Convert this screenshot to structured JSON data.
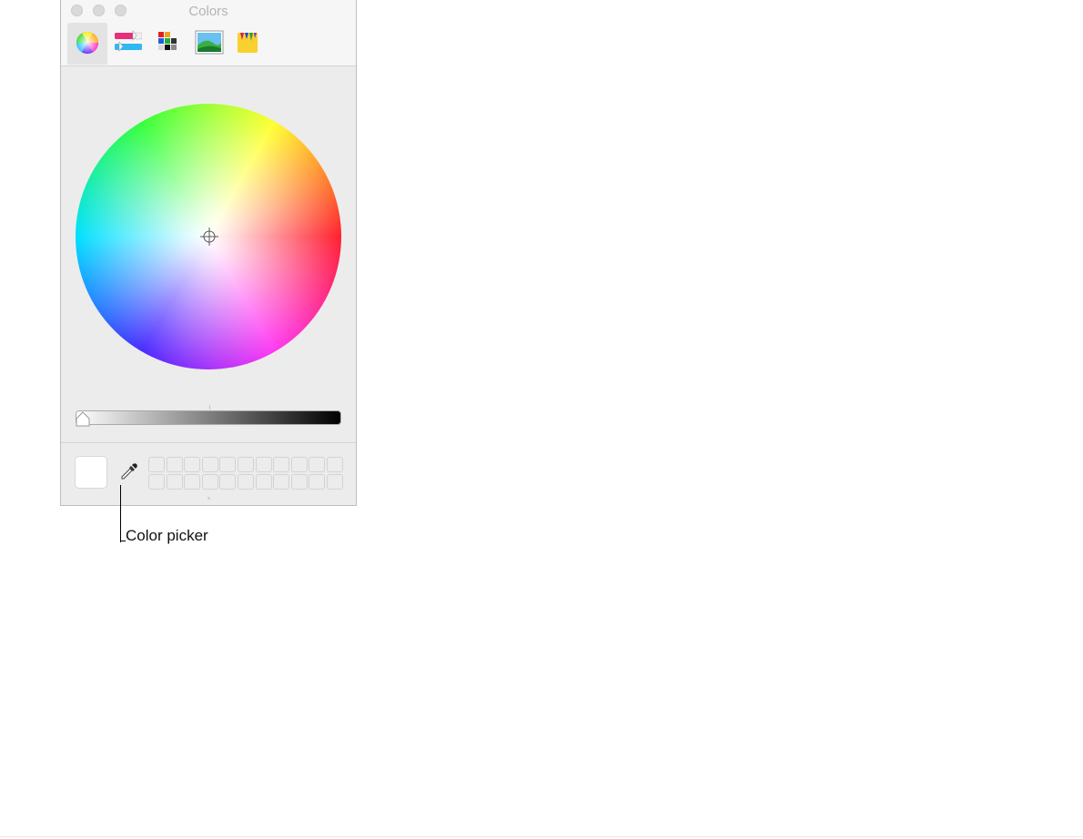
{
  "window": {
    "title": "Colors",
    "controls": [
      "close",
      "minimize",
      "zoom"
    ]
  },
  "toolbar": {
    "tools": [
      {
        "name": "color-wheel-icon",
        "active": true
      },
      {
        "name": "color-sliders-icon",
        "active": false
      },
      {
        "name": "color-palettes-icon",
        "active": false
      },
      {
        "name": "image-palettes-icon",
        "active": false
      },
      {
        "name": "pencils-icon",
        "active": false
      }
    ]
  },
  "wheel": {
    "hue_sequence": [
      "#ff1f2e",
      "#ff3af2",
      "#4a2bff",
      "#00e0ff",
      "#37ff3a",
      "#ffff30"
    ],
    "center_color": "#ffffff"
  },
  "brightness_slider": {
    "gradient_from": "#ffffff",
    "gradient_to": "#000000",
    "value_fraction": 0.0
  },
  "current_color": "#ffffff",
  "swatch_grid": {
    "rows": 2,
    "cols": 11
  },
  "callout": {
    "label": "Color picker"
  }
}
